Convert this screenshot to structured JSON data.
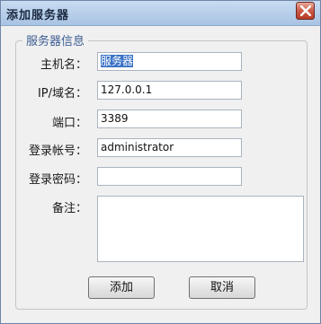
{
  "window": {
    "title": "添加服务器"
  },
  "group": {
    "title": "服务器信息"
  },
  "form": {
    "hostname_label": "主机名：",
    "hostname_value": "服务器",
    "ip_label": "IP/域名：",
    "ip_value": "127.0.0.1",
    "port_label": "端口：",
    "port_value": "3389",
    "account_label": "登录帐号：",
    "account_value": "administrator",
    "password_label": "登录密码：",
    "password_value": "",
    "note_label": "备注：",
    "note_value": ""
  },
  "buttons": {
    "add": "添加",
    "cancel": "取消"
  },
  "icons": {
    "close": "close-icon"
  },
  "colors": {
    "titlebar": "#b6cee9",
    "close": "#cc5a47",
    "selection": "#3a72c6",
    "group_title": "#3c5c92"
  }
}
